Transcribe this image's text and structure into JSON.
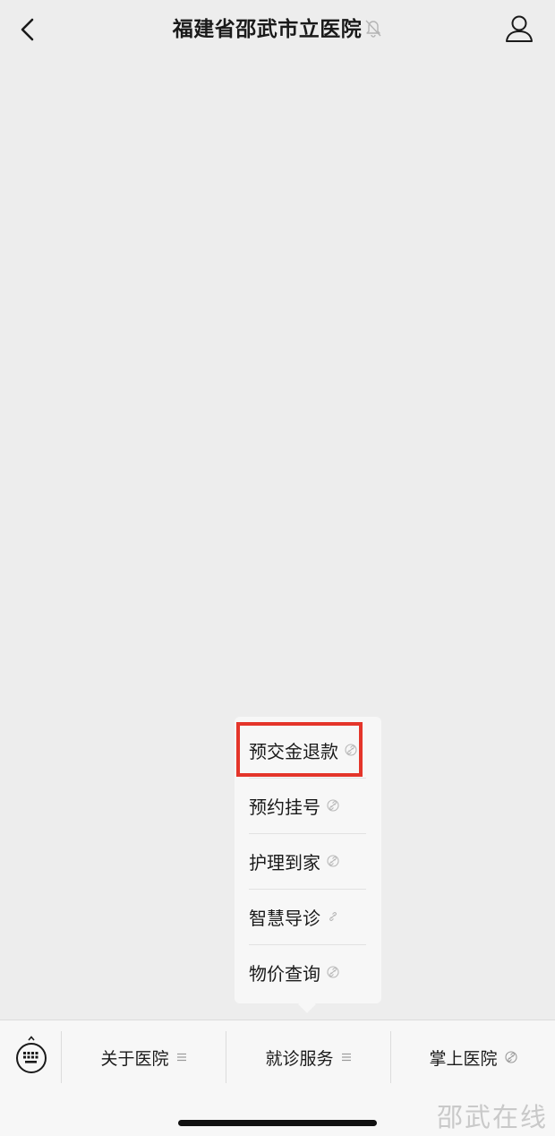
{
  "header": {
    "title": "福建省邵武市立医院",
    "back_icon": "chevron-left-icon",
    "mute_icon": "bell-slash-icon",
    "profile_icon": "person-icon"
  },
  "submenu": {
    "items": [
      {
        "label": "预交金退款",
        "icon": "link-icon",
        "highlighted": true
      },
      {
        "label": "预约挂号",
        "icon": "link-icon"
      },
      {
        "label": "护理到家",
        "icon": "link-icon"
      },
      {
        "label": "智慧导诊",
        "icon": "link-icon"
      },
      {
        "label": "物价查询",
        "icon": "link-icon"
      }
    ],
    "highlight_color": "#e4352a"
  },
  "menubar": {
    "keyboard_icon": "keyboard-icon",
    "items": [
      {
        "label": "关于医院",
        "icon": "menu-lines-icon"
      },
      {
        "label": "就诊服务",
        "icon": "menu-lines-icon",
        "active": true
      },
      {
        "label": "掌上医院",
        "icon": "link-icon"
      }
    ]
  },
  "watermark": "邵武在线"
}
